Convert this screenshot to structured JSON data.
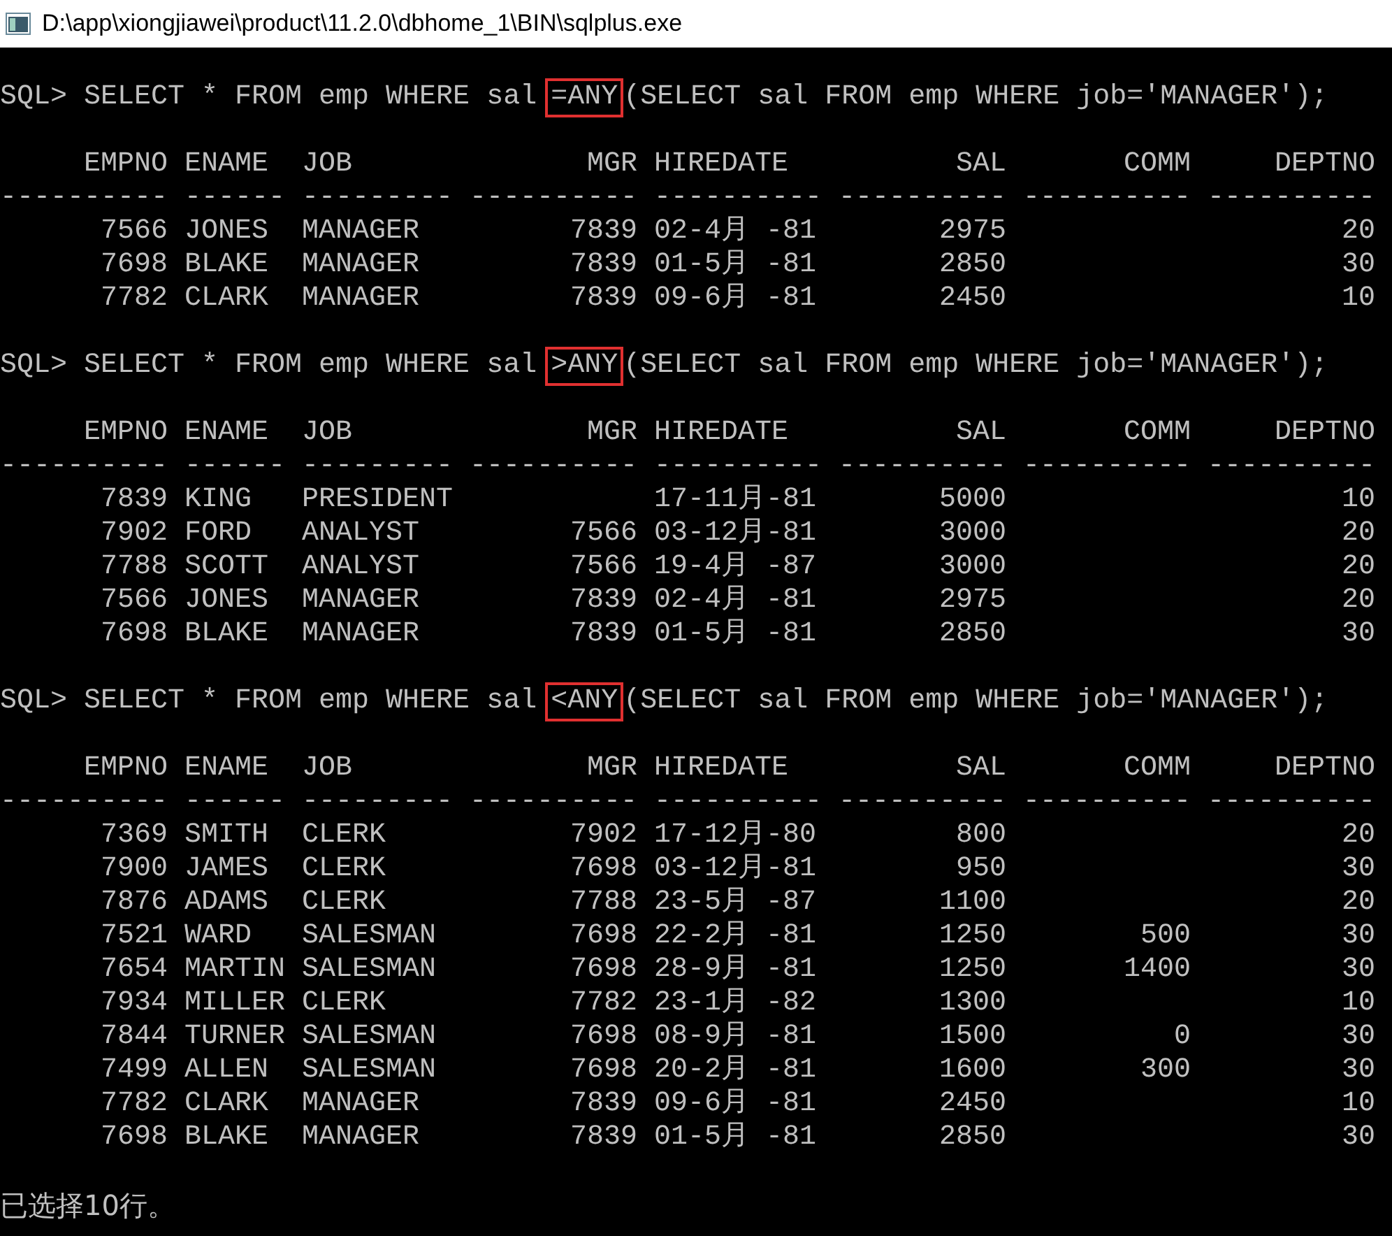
{
  "window": {
    "title": "D:\\app\\xiongjiawei\\product\\11.2.0\\dbhome_1\\BIN\\sqlplus.exe"
  },
  "queries": [
    {
      "prompt": "SQL>",
      "command": "SELECT * FROM emp WHERE sal",
      "operator": "=ANY",
      "subquery": "(SELECT sal FROM emp WHERE job='MANAGER');",
      "columns": [
        {
          "heading": "EMPNO",
          "rule": "----------"
        },
        {
          "heading": "ENAME",
          "rule": "------"
        },
        {
          "heading": "JOB",
          "rule": "---------"
        },
        {
          "heading": "MGR",
          "rule": "----------"
        },
        {
          "heading": "HIREDATE",
          "rule": "----------"
        },
        {
          "heading": "SAL",
          "rule": "----------"
        },
        {
          "heading": "COMM",
          "rule": "----------"
        },
        {
          "heading": "DEPTNO",
          "rule": "----------"
        }
      ],
      "rows": [
        [
          "7566",
          "JONES",
          "MANAGER",
          "7839",
          "02-4月 -81",
          "2975",
          null,
          "20"
        ],
        [
          "7698",
          "BLAKE",
          "MANAGER",
          "7839",
          "01-5月 -81",
          "2850",
          null,
          "30"
        ],
        [
          "7782",
          "CLARK",
          "MANAGER",
          "7839",
          "09-6月 -81",
          "2450",
          null,
          "10"
        ]
      ]
    },
    {
      "prompt": "SQL>",
      "command": "SELECT * FROM emp WHERE sal",
      "operator": ">ANY",
      "subquery": "(SELECT sal FROM emp WHERE job='MANAGER');",
      "columns": [
        {
          "heading": "EMPNO",
          "rule": "----------"
        },
        {
          "heading": "ENAME",
          "rule": "------"
        },
        {
          "heading": "JOB",
          "rule": "---------"
        },
        {
          "heading": "MGR",
          "rule": "----------"
        },
        {
          "heading": "HIREDATE",
          "rule": "----------"
        },
        {
          "heading": "SAL",
          "rule": "----------"
        },
        {
          "heading": "COMM",
          "rule": "----------"
        },
        {
          "heading": "DEPTNO",
          "rule": "----------"
        }
      ],
      "rows": [
        [
          "7839",
          "KING",
          "PRESIDENT",
          null,
          "17-11月-81",
          "5000",
          null,
          "10"
        ],
        [
          "7902",
          "FORD",
          "ANALYST",
          "7566",
          "03-12月-81",
          "3000",
          null,
          "20"
        ],
        [
          "7788",
          "SCOTT",
          "ANALYST",
          "7566",
          "19-4月 -87",
          "3000",
          null,
          "20"
        ],
        [
          "7566",
          "JONES",
          "MANAGER",
          "7839",
          "02-4月 -81",
          "2975",
          null,
          "20"
        ],
        [
          "7698",
          "BLAKE",
          "MANAGER",
          "7839",
          "01-5月 -81",
          "2850",
          null,
          "30"
        ]
      ]
    },
    {
      "prompt": "SQL>",
      "command": "SELECT * FROM emp WHERE sal",
      "operator": "<ANY",
      "subquery": "(SELECT sal FROM emp WHERE job='MANAGER');",
      "columns": [
        {
          "heading": "EMPNO",
          "rule": "----------"
        },
        {
          "heading": "ENAME",
          "rule": "------"
        },
        {
          "heading": "JOB",
          "rule": "---------"
        },
        {
          "heading": "MGR",
          "rule": "----------"
        },
        {
          "heading": "HIREDATE",
          "rule": "----------"
        },
        {
          "heading": "SAL",
          "rule": "----------"
        },
        {
          "heading": "COMM",
          "rule": "----------"
        },
        {
          "heading": "DEPTNO",
          "rule": "----------"
        }
      ],
      "rows": [
        [
          "7369",
          "SMITH",
          "CLERK",
          "7902",
          "17-12月-80",
          "800",
          null,
          "20"
        ],
        [
          "7900",
          "JAMES",
          "CLERK",
          "7698",
          "03-12月-81",
          "950",
          null,
          "30"
        ],
        [
          "7876",
          "ADAMS",
          "CLERK",
          "7788",
          "23-5月 -87",
          "1100",
          null,
          "20"
        ],
        [
          "7521",
          "WARD",
          "SALESMAN",
          "7698",
          "22-2月 -81",
          "1250",
          "500",
          "30"
        ],
        [
          "7654",
          "MARTIN",
          "SALESMAN",
          "7698",
          "28-9月 -81",
          "1250",
          "1400",
          "30"
        ],
        [
          "7934",
          "MILLER",
          "CLERK",
          "7782",
          "23-1月 -82",
          "1300",
          null,
          "10"
        ],
        [
          "7844",
          "TURNER",
          "SALESMAN",
          "7698",
          "08-9月 -81",
          "1500",
          "0",
          "30"
        ],
        [
          "7499",
          "ALLEN",
          "SALESMAN",
          "7698",
          "20-2月 -81",
          "1600",
          "300",
          "30"
        ],
        [
          "7782",
          "CLARK",
          "MANAGER",
          "7839",
          "09-6月 -81",
          "2450",
          null,
          "10"
        ],
        [
          "7698",
          "BLAKE",
          "MANAGER",
          "7839",
          "01-5月 -81",
          "2850",
          null,
          "30"
        ]
      ]
    }
  ],
  "status_message": "已选择10行。"
}
